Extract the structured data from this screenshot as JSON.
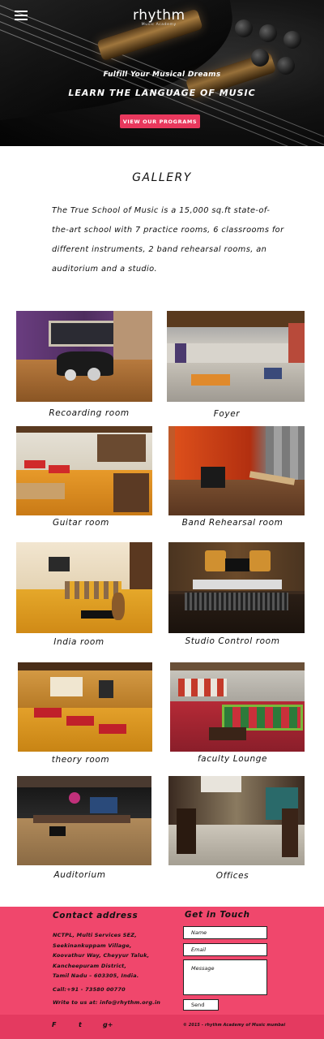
{
  "header": {
    "menu_icon": "hamburger-menu-icon",
    "brand": "rhythm",
    "brand_sub": "Music Academy",
    "tagline_1": "Fulfill Your Musical Dreams",
    "tagline_2": "LEARN THE LANGUAGE OF MUSIC",
    "cta_label": "VIEW OUR PROGRAMS"
  },
  "gallery": {
    "title": "GALLERY",
    "intro": "The True School of Music is a 15,000 sq.ft state-of-the-art school with 7 practice rooms, 6 classrooms for different instruments, 2 band rehearsal rooms, an auditorium and a studio.",
    "items": [
      {
        "caption": "Recoarding room"
      },
      {
        "caption": "Foyer"
      },
      {
        "caption": "Guitar room"
      },
      {
        "caption": "Band Rehearsal room"
      },
      {
        "caption": "India room"
      },
      {
        "caption": "Studio Control room"
      },
      {
        "caption": "theory room"
      },
      {
        "caption": "faculty Lounge"
      },
      {
        "caption": "Auditorium"
      },
      {
        "caption": "Offices"
      }
    ]
  },
  "footer": {
    "contact_title": "Contact address",
    "address_lines": [
      "NCTPL, Multi Services SEZ,",
      "Seekinankuppam Village,",
      "Koovathur Way, Cheyyur Taluk,",
      "Kancheepuram District,",
      "Tamil Nadu – 603305, India."
    ],
    "call": "Call:+91 - 73580 00770",
    "write": "Write to us at: info@rhythm.org.in",
    "get_in_touch_title": "Get in Touch",
    "name_placeholder": "Name",
    "email_placeholder": "Email",
    "message_placeholder": "Message",
    "send_label": "Send",
    "social": {
      "facebook": "F",
      "twitter": "t",
      "googleplus": "g+"
    },
    "copyright": "© 2015 - rhythm Academy of Music mumbai"
  },
  "colors": {
    "accent": "#e8385d",
    "footer": "#f0476c",
    "footer_bottom": "#e43a60"
  }
}
